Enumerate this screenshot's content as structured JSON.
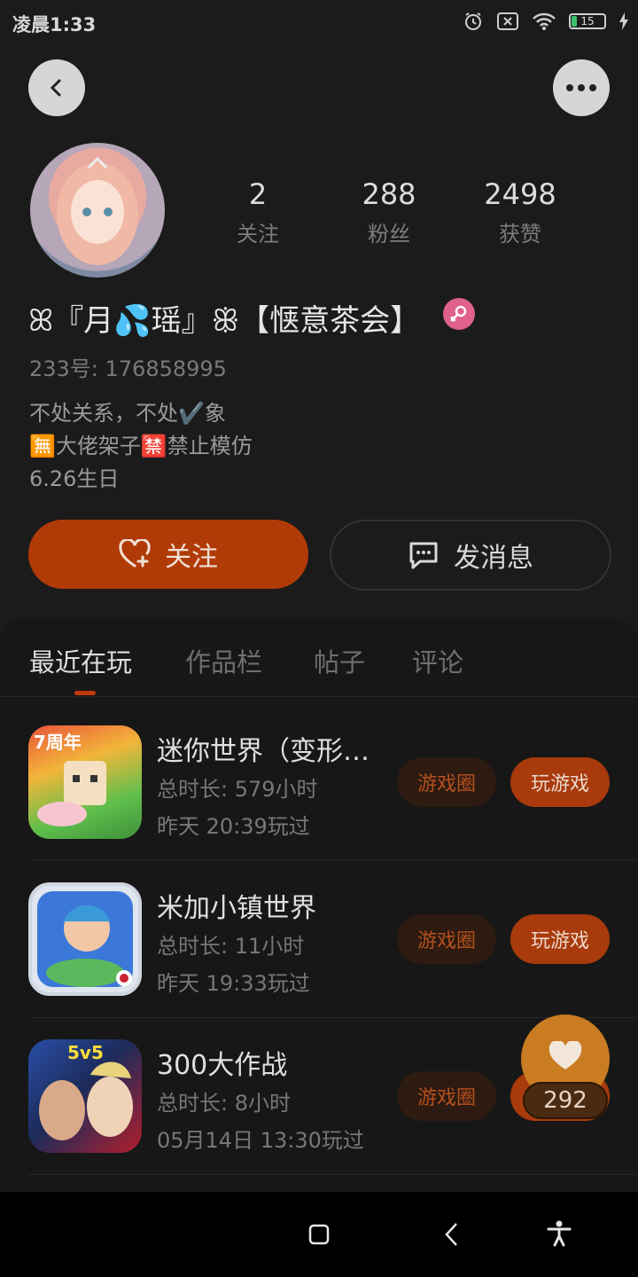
{
  "status_bar": {
    "time": "凌晨1:33",
    "battery": "15"
  },
  "profile": {
    "stats": [
      {
        "value": "2",
        "label": "关注"
      },
      {
        "value": "288",
        "label": "粉丝"
      },
      {
        "value": "2498",
        "label": "获赞"
      }
    ],
    "nickname": "ꕤ『月💦瑶』ꕥ【惬意茶会】",
    "uid": "233号: 176858995",
    "bio": [
      "不处关系，不处✔️象",
      "🈚大佬架子🈲禁止模仿",
      "6.26生日"
    ],
    "follow_label": "关注",
    "message_label": "发消息"
  },
  "tabs": [
    "最近在玩",
    "作品栏",
    "帖子",
    "评论"
  ],
  "games": [
    {
      "title": "迷你世界（变形…",
      "duration": "总时长: 579小时",
      "last_played": "昨天 20:39玩过",
      "circle_label": "游戏圈",
      "play_label": "玩游戏",
      "icon": "mini-world-icon",
      "icon_text": "7周年"
    },
    {
      "title": "米加小镇世界",
      "duration": "总时长: 11小时",
      "last_played": "昨天 19:33玩过",
      "circle_label": "游戏圈",
      "play_label": "玩游戏",
      "icon": "miga-town-icon",
      "icon_text": ""
    },
    {
      "title": "300大作战",
      "duration": "总时长: 8小时",
      "last_played": "05月14日 13:30玩过",
      "circle_label": "游戏圈",
      "play_label": "玩游戏",
      "icon": "300-battle-icon",
      "icon_text": "5v5"
    }
  ],
  "like_fab": {
    "count": "292"
  },
  "colors": {
    "accent": "#b13b07",
    "like": "#c97c22",
    "background": "#1b1b1b"
  }
}
